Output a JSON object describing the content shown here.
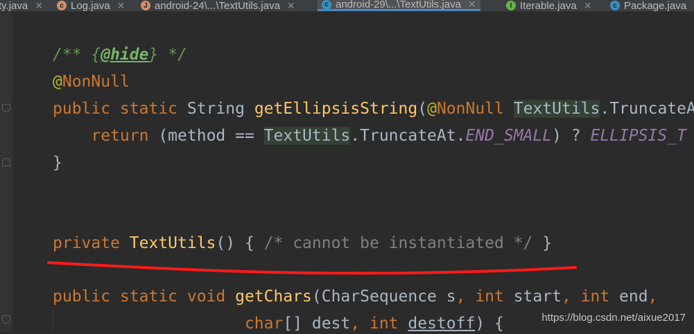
{
  "tabs": [
    {
      "label": "ty.java",
      "icon": "",
      "icon_color": ""
    },
    {
      "label": "Log.java",
      "icon": "class-icon",
      "icon_color": "#cf8e6d"
    },
    {
      "label": "android-24\\...\\TextUtils.java",
      "icon": "class-icon",
      "icon_color": "#cf8e6d"
    },
    {
      "label": "android-29\\...\\TextUtils.java",
      "icon": "class-icon",
      "icon_color": "#3592c4",
      "active": true
    },
    {
      "label": "Iterable.java",
      "icon": "interface-icon",
      "icon_color": "#62b543"
    },
    {
      "label": "Package.java",
      "icon": "class-icon",
      "icon_color": "#3592c4"
    }
  ],
  "code": {
    "l1": {
      "open": "/** {",
      "tag": "@hide",
      "close": "} */"
    },
    "l2": {
      "at": "@",
      "ann": "NonNull"
    },
    "l3": {
      "kw1": "public static ",
      "type": "String ",
      "fn": "getEllipsisString",
      "p1": "(",
      "at": "@",
      "ann": "NonNull",
      "sp": " ",
      "cls": "TextUtils",
      "rest": ".TruncateA"
    },
    "l4": {
      "indent": "    ",
      "kw": "return ",
      "p1": "(method == ",
      "cls": "TextUtils",
      "mid": ".TruncateAt.",
      "cst": "END_SMALL",
      "p2": ") ? ",
      "cst2": "ELLIPSIS_T"
    },
    "l5": {
      "text": "}"
    },
    "l6": {
      "kw": "private ",
      "fn": "TextUtils",
      "p1": "() { ",
      "cm": "/* cannot be instantiated */",
      "p2": " }"
    },
    "l7": {
      "kw1": "public static void ",
      "fn": "getChars",
      "p1": "(CharSequence s",
      "c1": ", ",
      "kw2": "int ",
      "p2": "start",
      "c2": ", ",
      "kw3": "int ",
      "p3": "end",
      "c3": ","
    },
    "l8": {
      "indent": "                    ",
      "kw1": "char",
      "p1": "[] dest",
      "c1": ", ",
      "kw2": "int ",
      "p2": "destoff",
      "p3": ") {"
    }
  },
  "watermark": "https://blog.csdn.net/aixue2017",
  "colors": {
    "background": "#2b2b2b",
    "keyword": "#cc7832",
    "annotation": "#bbb529",
    "function": "#ffc66d",
    "comment": "#808080",
    "doc": "#629755",
    "constant": "#9876aa",
    "underline_mark": "#ff1a1a"
  }
}
